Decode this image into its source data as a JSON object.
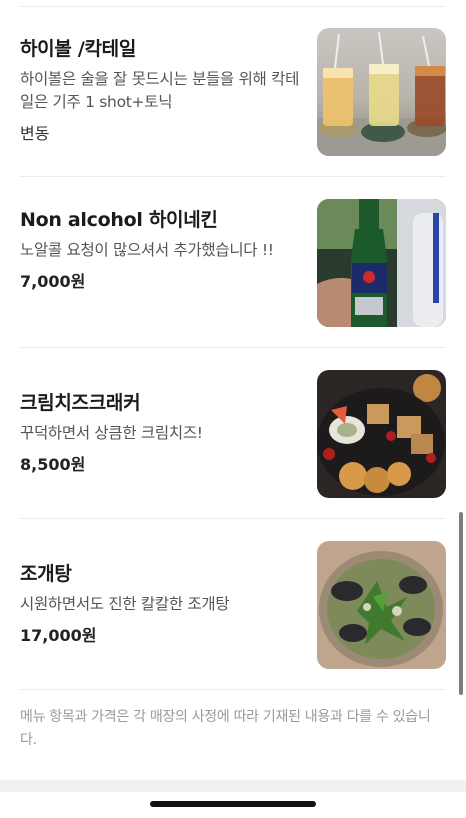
{
  "menu": {
    "items": [
      {
        "name": "하이볼 /칵테일",
        "description": "하이볼은 술을 잘 못드시는 분들을 위해 칵테일은 기주 1 shot+토닉",
        "price": "변동",
        "image_icon": "highball-cocktail-photo-icon"
      },
      {
        "name": "Non alcohol 하이네킨",
        "description": "노알콜 요청이 많으셔서 추가했습니다 !!",
        "price": "7,000원",
        "image_icon": "heineken-bottle-photo-icon"
      },
      {
        "name": "크림치즈크래커",
        "description": "꾸덕하면서 상큼한 크림치즈!",
        "price": "8,500원",
        "image_icon": "cheese-cracker-plate-photo-icon"
      },
      {
        "name": "조개탕",
        "description": "시원하면서도 진한 칼칼한 조개탕",
        "price": "17,000원",
        "image_icon": "clam-soup-photo-icon"
      }
    ]
  },
  "notice": "메뉴 항목과 가격은 각 매장의 사정에 따라 기재된 내용과 다를 수 있습니다.",
  "colors": {
    "divider": "#ececec",
    "name_text": "#1b1b1b",
    "desc_text": "#555555",
    "notice_text": "#9a9a9a",
    "background": "#ffffff"
  }
}
